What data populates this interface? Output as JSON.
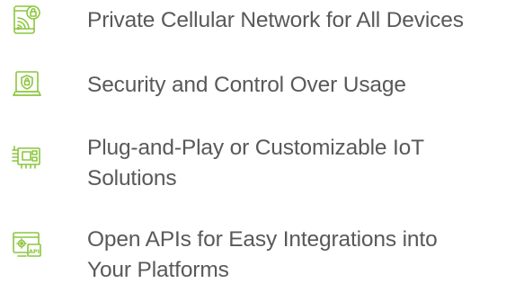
{
  "accent_color": "#8cc63f",
  "text_color": "#595959",
  "features": [
    {
      "icon": "cellular-network-icon",
      "label": "Private Cellular Network for All Devices"
    },
    {
      "icon": "security-lock-icon",
      "label": "Security and Control Over Usage"
    },
    {
      "icon": "iot-board-icon",
      "label": "Plug-and-Play or Customizable IoT Solutions"
    },
    {
      "icon": "api-integration-icon",
      "label": "Open APIs for Easy Integrations into Your Platforms"
    }
  ]
}
